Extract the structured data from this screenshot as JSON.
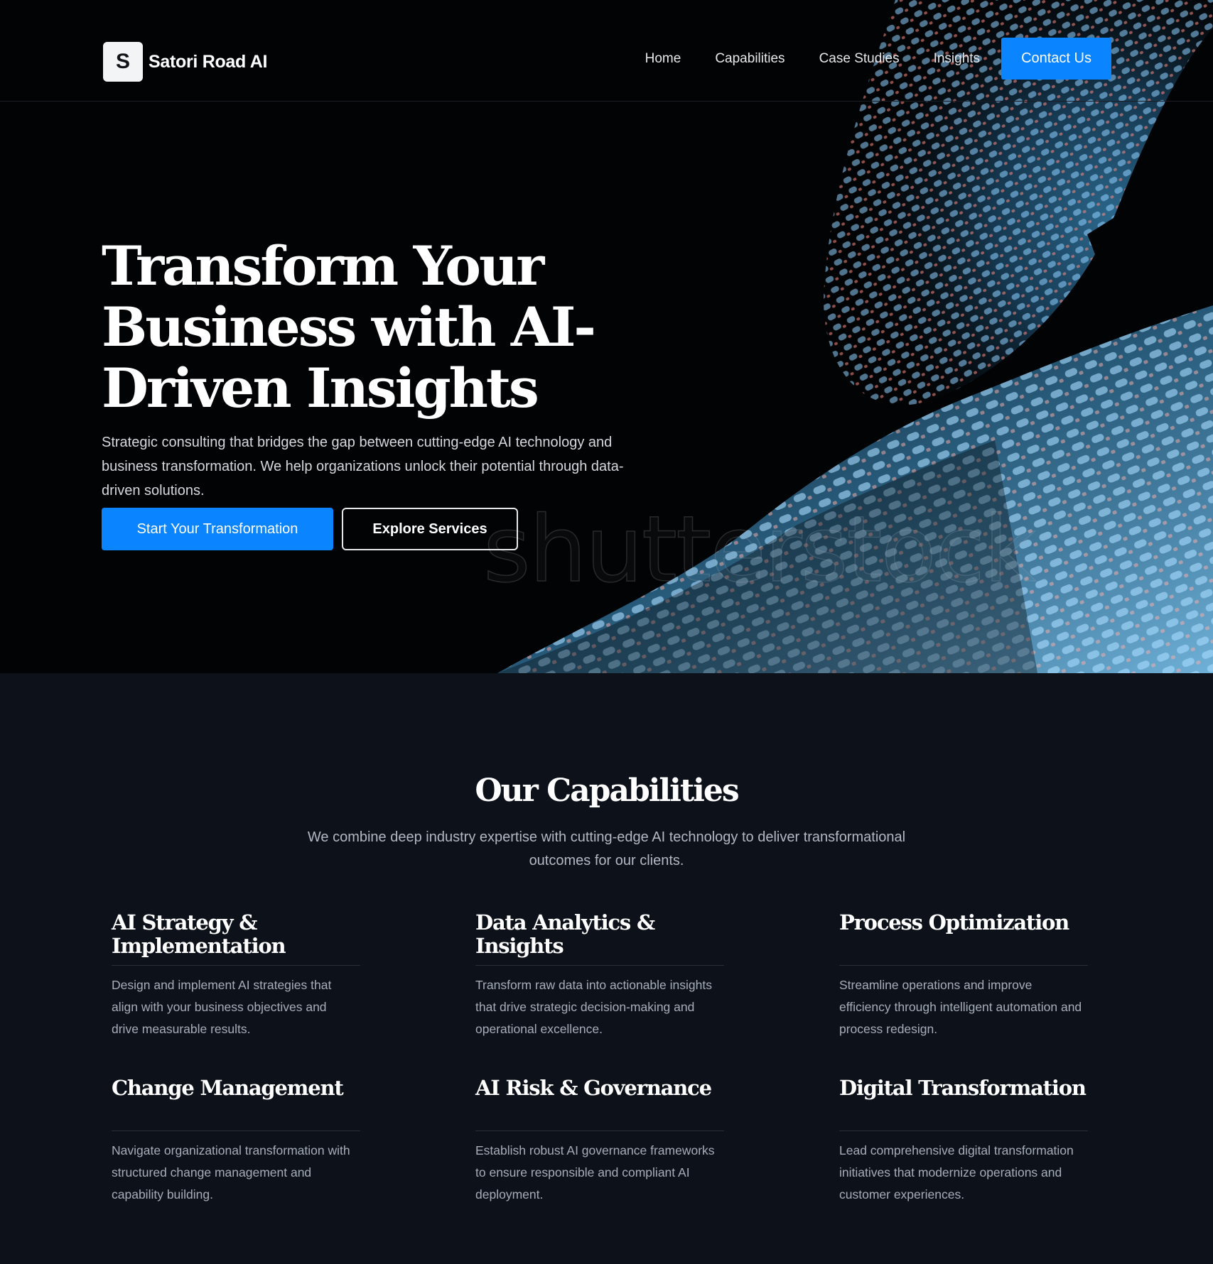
{
  "brand": {
    "logo_letter": "S",
    "name": "Satori Road AI"
  },
  "nav": {
    "items": [
      "Home",
      "Capabilities",
      "Case Studies",
      "Insights"
    ],
    "cta": "Contact Us"
  },
  "hero": {
    "title": "Transform Your Business with AI-Driven Insights",
    "subtitle": "Strategic consulting that bridges the gap between cutting-edge AI technology and business transformation. We help organizations unlock their potential through data-driven solutions.",
    "primary_button": "Start Your Transformation",
    "secondary_button": "Explore Services",
    "watermark": "shutterstock"
  },
  "capabilities": {
    "title": "Our Capabilities",
    "subtitle": "We combine deep industry expertise with cutting-edge AI technology to deliver transformational outcomes for our clients.",
    "items": [
      {
        "title": "AI Strategy & Implementation",
        "desc": "Design and implement AI strategies that align with your business objectives and drive measurable results."
      },
      {
        "title": "Data Analytics & Insights",
        "desc": "Transform raw data into actionable insights that drive strategic decision-making and operational excellence."
      },
      {
        "title": "Process Optimization",
        "desc": "Streamline operations and improve efficiency through intelligent automation and process redesign."
      },
      {
        "title": "Change Management",
        "desc": "Navigate organizational transformation with structured change management and capability building."
      },
      {
        "title": "AI Risk & Governance",
        "desc": "Establish robust AI governance frameworks to ensure responsible and compliant AI deployment."
      },
      {
        "title": "Digital Transformation",
        "desc": "Lead comprehensive digital transformation initiatives that modernize operations and customer experiences."
      }
    ]
  },
  "colors": {
    "accent": "#0a84ff",
    "hero_bg": "#020304",
    "section_bg": "#0d111a"
  }
}
